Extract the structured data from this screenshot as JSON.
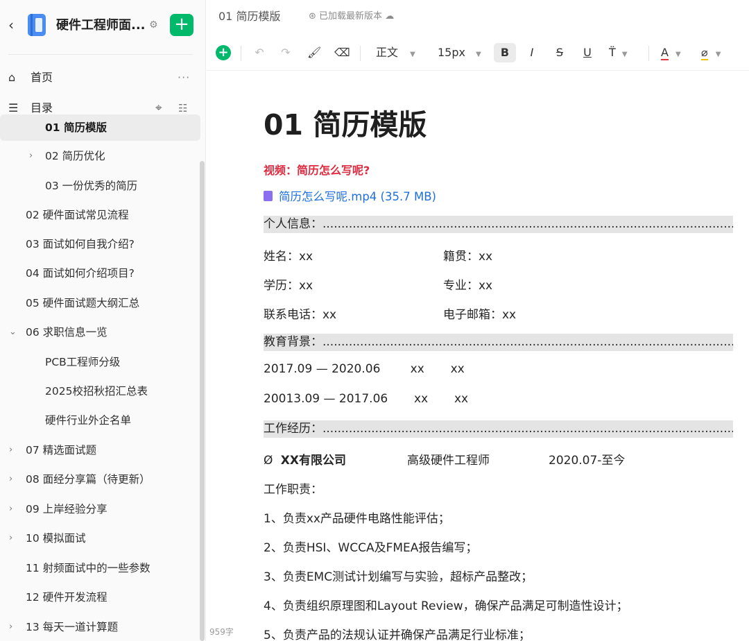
{
  "sidebar": {
    "back_icon": "chevron-left-icon",
    "kb_title": "硬件工程师面...",
    "home_label": "首页",
    "toc_label": "目录",
    "items": [
      {
        "label": "01 简历模版",
        "active": true
      },
      {
        "label": "02 简历优化"
      },
      {
        "label": "03 一份优秀的简历"
      },
      {
        "label": "02 硬件面试常见流程"
      },
      {
        "label": "03 面试如何自我介绍?"
      },
      {
        "label": "04 面试如何介绍项目?"
      },
      {
        "label": "05 硬件面试题大纲汇总"
      },
      {
        "label": "06 求职信息一览"
      },
      {
        "label": "PCB工程师分级"
      },
      {
        "label": "2025校招秋招汇总表"
      },
      {
        "label": "硬件行业外企名单"
      },
      {
        "label": "07 精选面试题"
      },
      {
        "label": "08 面经分享篇（待更新）"
      },
      {
        "label": "09 上岸经验分享"
      },
      {
        "label": "10 模拟面试"
      },
      {
        "label": "11 射频面试中的一些参数"
      },
      {
        "label": "12 硬件开发流程"
      },
      {
        "label": "13 每天一道计算题"
      }
    ]
  },
  "topbar": {
    "doc_tab": "01 简历模版",
    "status": "已加载最新版本"
  },
  "toolbar": {
    "style_value": "正文",
    "font_size_value": "15px",
    "bold": "B",
    "italic": "I",
    "strike": "S",
    "underline": "U",
    "font_color": "A"
  },
  "doc": {
    "title": "01  简历模版",
    "video_title": "视频：简历怎么写呢?",
    "attachment": "简历怎么写呢.mp4  (35.7 MB)",
    "personal_header": "个人信息：.......................................................................................................................................................",
    "personal": [
      {
        "left": "姓名：xx",
        "right": "籍贯：xx"
      },
      {
        "left": "学历：xx",
        "right": "专业：xx"
      },
      {
        "left": "联系电话：xx",
        "right": "电子邮箱：xx"
      }
    ],
    "edu_header": "教育背景：.......................................................................................................................................................",
    "edu": [
      "2017.09 — 2020.06        xx       xx",
      "20013.09 — 2017.06       xx       xx"
    ],
    "work_header": "工作经历：.......................................................................................................................................................",
    "company_bullet": "Ø",
    "company": "XX有限公司",
    "position": "高级硬件工程师",
    "period": "2020.07-至今",
    "duties_label": "工作职责：",
    "duties": [
      "1、负责xx产品硬件电路性能评估；",
      "2、负责HSI、WCCA及FMEA报告编写；",
      "3、负责EMC测试计划编写与实验，超标产品整改；",
      "4、负责组织原理图和Layout Review，确保产品满足可制造性设计；",
      "5、负责产品的法规认证并确保产品满足行业标准；"
    ]
  },
  "word_count": "959字"
}
